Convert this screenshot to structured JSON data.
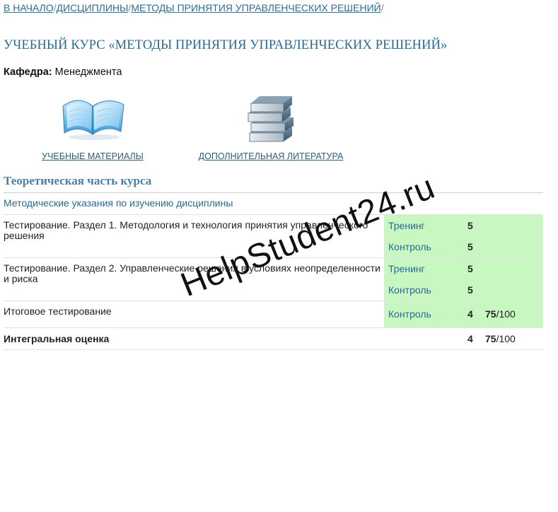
{
  "breadcrumb": {
    "items": [
      "В НАЧАЛО",
      "ДИСЦИПЛИНЫ",
      "МЕТОДЫ ПРИНЯТИЯ УПРАВЛЕНЧЕСКИХ РЕШЕНИЙ"
    ],
    "separator": "/"
  },
  "course": {
    "title": "УЧЕБНЫЙ КУРС «МЕТОДЫ ПРИНЯТИЯ УПРАВЛЕНЧЕСКИХ РЕШЕНИЙ»",
    "dept_label": "Кафедра:",
    "dept_value": "Менеджмента"
  },
  "resources": [
    {
      "label": "УЧЕБНЫЕ МАТЕРИАЛЫ",
      "icon": "open-book-icon"
    },
    {
      "label": "ДОПОЛНИТЕЛЬНАЯ ЛИТЕРАТУРА",
      "icon": "book-stack-icon"
    }
  ],
  "section": {
    "title": "Теоретическая часть курса",
    "method_link": "Методические указания по изучению дисциплины"
  },
  "tests": [
    {
      "name": "Тестирование. Раздел 1. Методология и технология принятия управленческого решения",
      "rows": [
        {
          "type": "Тренинг",
          "score": "5"
        },
        {
          "type": "Контроль",
          "score": "5"
        }
      ]
    },
    {
      "name": "Тестирование. Раздел 2. Управленческие решения в условиях неопределенности и риска",
      "rows": [
        {
          "type": "Тренинг",
          "score": "5"
        },
        {
          "type": "Контроль",
          "score": "5"
        }
      ]
    },
    {
      "name": "Итоговое тестирование",
      "rows": [
        {
          "type": "Контроль",
          "score": "4",
          "points": "75",
          "max": "/100"
        }
      ]
    }
  ],
  "integral": {
    "label": "Интегральная оценка",
    "score": "4",
    "points": "75",
    "max": "/100"
  },
  "watermark": "HelpStudent24.ru",
  "colors": {
    "link": "#2a6a93",
    "section_title": "#4a7fa8",
    "result_bg": "#c8f7c1"
  }
}
